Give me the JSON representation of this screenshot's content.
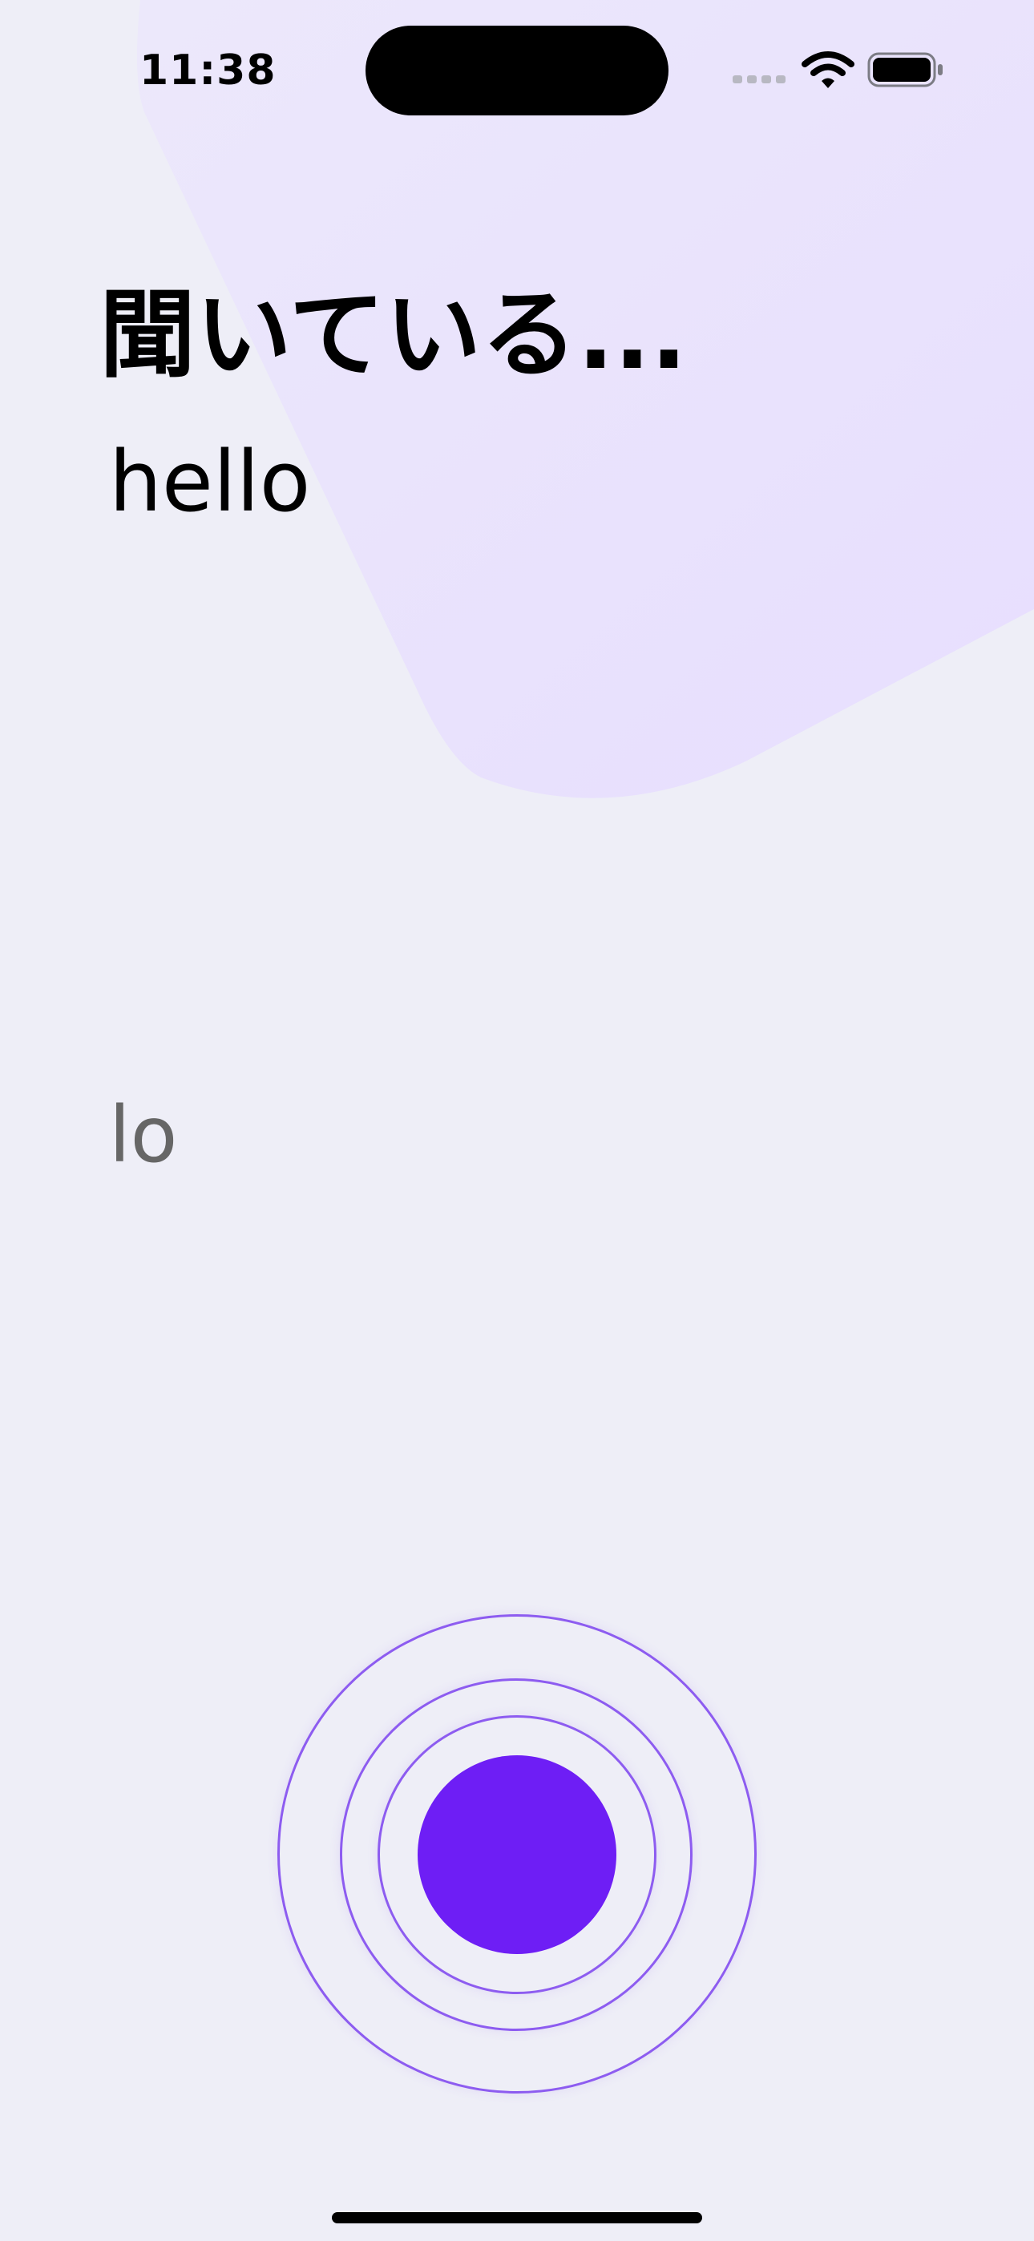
{
  "status_bar": {
    "time": "11:38",
    "icons": [
      "signal-icon",
      "wifi-icon",
      "battery-icon"
    ]
  },
  "main": {
    "title": "聞いている...",
    "transcript_primary": "hello",
    "transcript_partial": "lo"
  },
  "mic": {
    "icon": "record-button"
  },
  "colors": {
    "background": "#EEEEF7",
    "blob": "#E8E0FE",
    "accent": "#6E1EF5",
    "ring": "#8D5CF0",
    "partial_text": "#666666"
  }
}
